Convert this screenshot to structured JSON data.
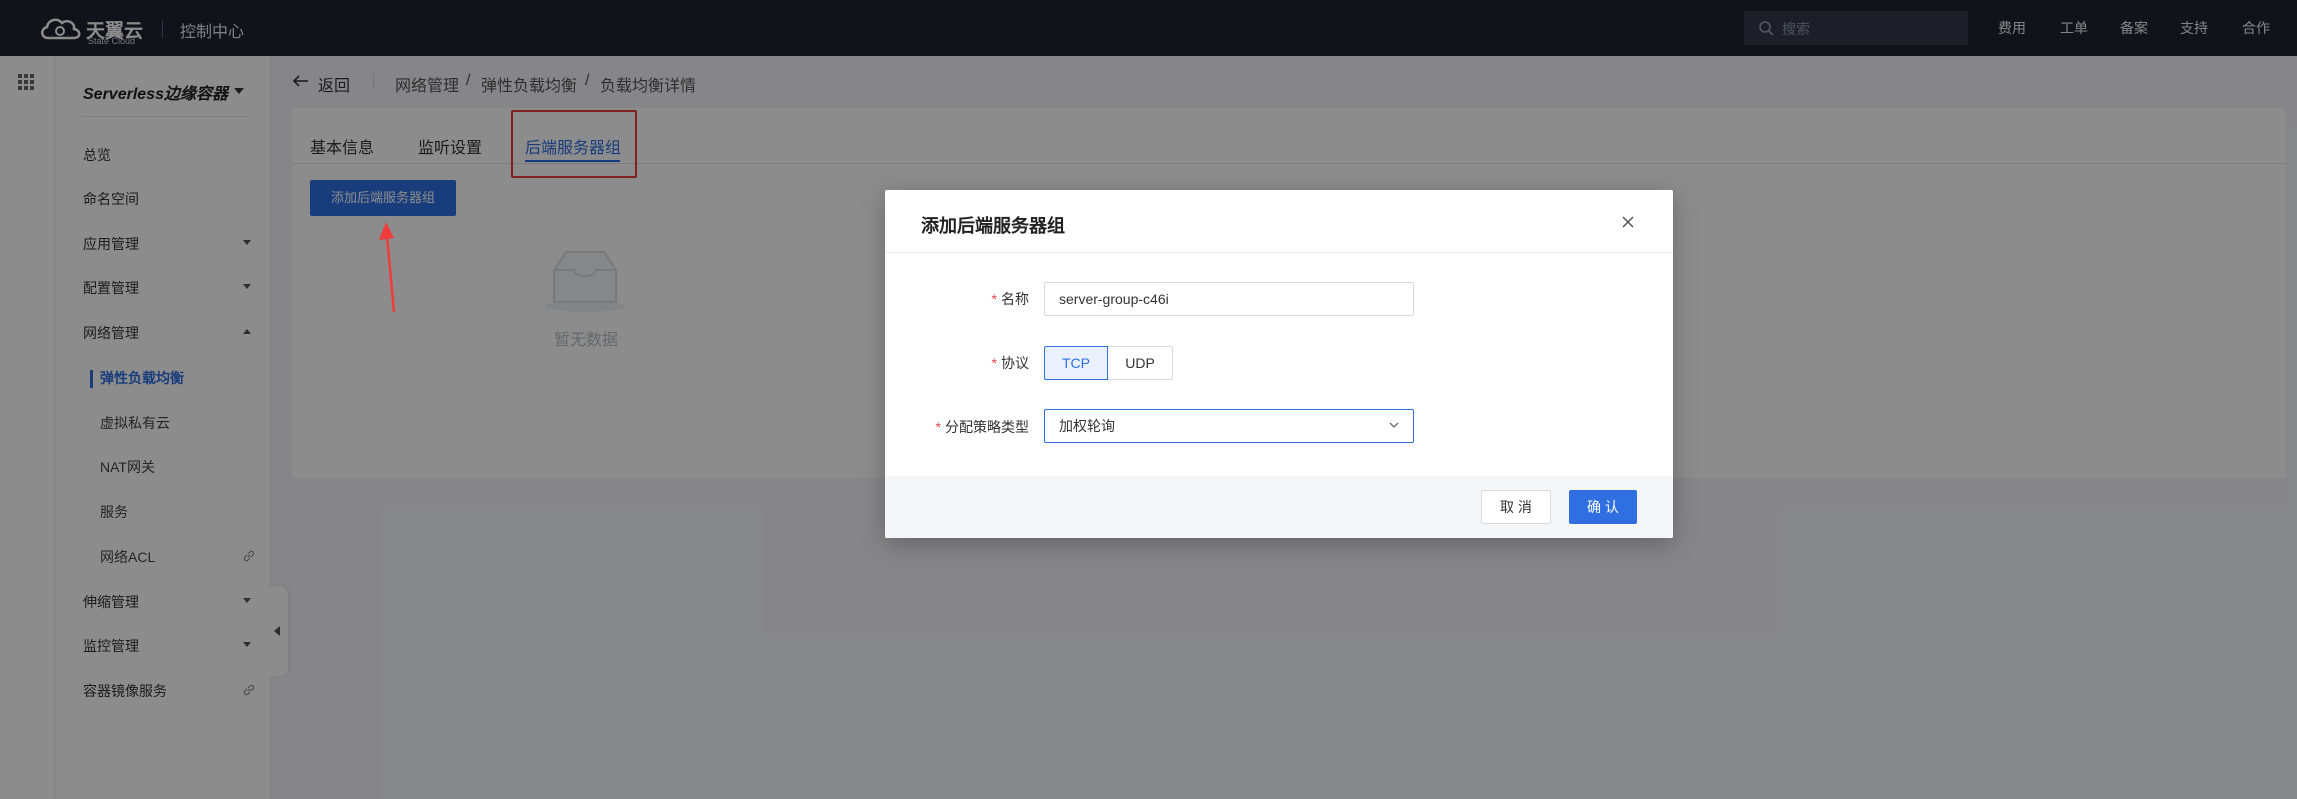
{
  "topbar": {
    "brand": "天翼云",
    "brand_sub": "State Cloud",
    "console": "控制中心",
    "search_placeholder": "搜索",
    "nav": [
      "费用",
      "工单",
      "备案",
      "支持",
      "合作"
    ]
  },
  "sidebar": {
    "title": "Serverless边缘容器",
    "items": [
      {
        "label": "总览"
      },
      {
        "label": "命名空间"
      },
      {
        "label": "应用管理"
      },
      {
        "label": "配置管理"
      },
      {
        "label": "网络管理"
      },
      {
        "label": "伸缩管理"
      },
      {
        "label": "监控管理"
      },
      {
        "label": "容器镜像服务"
      }
    ],
    "network_sub": [
      {
        "label": "弹性负载均衡"
      },
      {
        "label": "虚拟私有云"
      },
      {
        "label": "NAT网关"
      },
      {
        "label": "服务"
      },
      {
        "label": "网络ACL"
      }
    ]
  },
  "breadcrumb": {
    "back": "返回",
    "items": [
      "网络管理",
      "弹性负载均衡",
      "负载均衡详情"
    ]
  },
  "tabs": [
    "基本信息",
    "监听设置",
    "后端服务器组"
  ],
  "content": {
    "add_button": "添加后端服务器组",
    "empty_text": "暂无数据"
  },
  "modal": {
    "title": "添加后端服务器组",
    "name_label": "名称",
    "name_value": "server-group-c46i",
    "protocol_label": "协议",
    "protocol_options": [
      "TCP",
      "UDP"
    ],
    "strategy_label": "分配策略类型",
    "strategy_value": "加权轮询",
    "cancel": "取 消",
    "confirm": "确 认"
  },
  "colors": {
    "accent": "#2f6fe2",
    "annotation_red": "#ef3b3b",
    "topbar_bg": "#1f2430"
  }
}
